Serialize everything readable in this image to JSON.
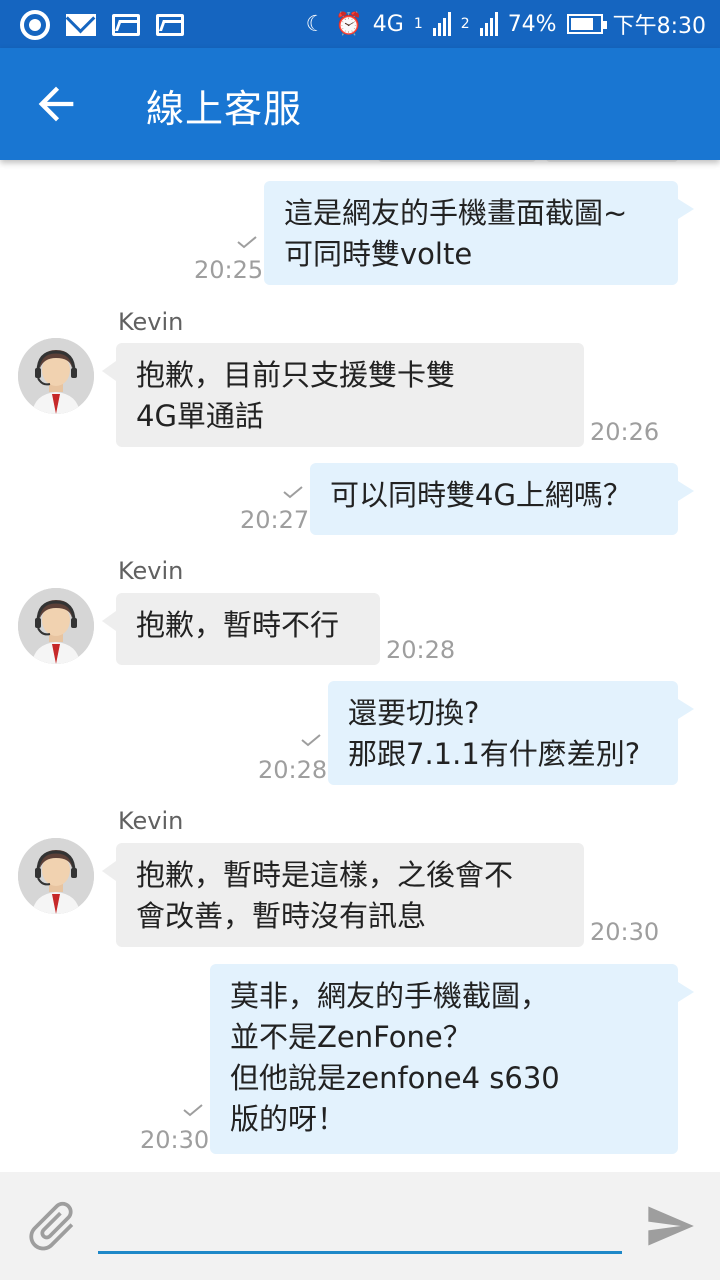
{
  "status_bar": {
    "network_label": "4G",
    "sim1_label": "1",
    "sim2_label": "2",
    "battery_percent": "74%",
    "time": "下午8:30",
    "icons": [
      "chrome-icon",
      "mail-icon",
      "image-icon",
      "image-icon",
      "moon-alarm-icon",
      "alarm-icon",
      "signal-icon",
      "battery-icon"
    ]
  },
  "header": {
    "title": "線上客服"
  },
  "colors": {
    "status_bar": "#1565c0",
    "app_bar": "#1976d2",
    "outgoing_bubble": "#e3f2fd",
    "incoming_bubble": "#eeeeee",
    "input_underline": "#1e88c8"
  },
  "messages": [
    {
      "direction": "out",
      "text": "這是網友的手機畫面截圖~\n可同時雙volte",
      "time": "20:25"
    },
    {
      "direction": "in",
      "sender": "Kevin",
      "text": "抱歉，目前只支援雙卡雙\n4G單通話",
      "time": "20:26"
    },
    {
      "direction": "out",
      "text": "可以同時雙4G上網嗎？",
      "time": "20:27"
    },
    {
      "direction": "in",
      "sender": "Kevin",
      "text": "抱歉，暫時不行",
      "time": "20:28"
    },
    {
      "direction": "out",
      "text": "還要切換?\n那跟7.1.1有什麼差別?",
      "time": "20:28"
    },
    {
      "direction": "in",
      "sender": "Kevin",
      "text": "抱歉，暫時是這樣，之後會不\n會改善，暫時沒有訊息",
      "time": "20:30"
    },
    {
      "direction": "out",
      "text": "莫非，網友的手機截圖，\n並不是ZenFone？\n但他說是zenfone4 s630\n版的呀！",
      "time": "20:30"
    }
  ],
  "input": {
    "value": "",
    "placeholder": ""
  }
}
